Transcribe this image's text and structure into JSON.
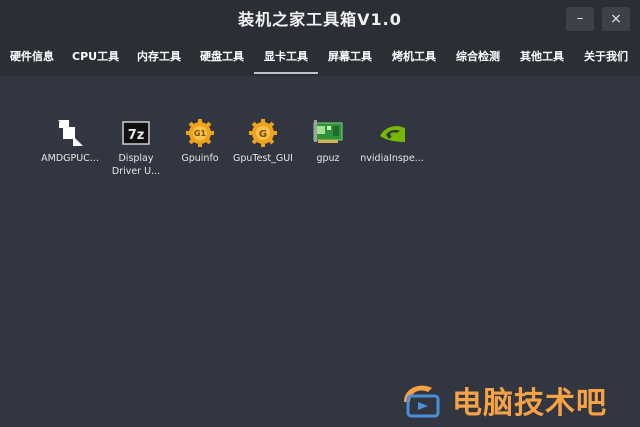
{
  "window": {
    "title": "装机之家工具箱V1.0",
    "minimize": "–",
    "close": "×"
  },
  "menu": {
    "items": [
      {
        "label": "硬件信息"
      },
      {
        "label": "CPU工具"
      },
      {
        "label": "内存工具"
      },
      {
        "label": "硬盘工具"
      },
      {
        "label": "显卡工具",
        "active": true
      },
      {
        "label": "屏幕工具"
      },
      {
        "label": "烤机工具"
      },
      {
        "label": "综合检测"
      },
      {
        "label": "其他工具"
      },
      {
        "label": "关于我们"
      }
    ]
  },
  "tools": [
    {
      "label": "AMDGPUC...",
      "icon": "amd-gpu-clock-icon"
    },
    {
      "label": "Display\nDriver U...",
      "icon": "7z-archive-icon"
    },
    {
      "label": "Gpuinfo",
      "icon": "gpuinfo-gear-icon"
    },
    {
      "label": "GpuTest_GUI",
      "icon": "gputest-gear-icon"
    },
    {
      "label": "gpuz",
      "icon": "graphics-card-icon"
    },
    {
      "label": "nvidiaInspe...",
      "icon": "nvidia-logo-icon"
    }
  ],
  "watermark": {
    "text": "电脑技术吧",
    "color": "#f7a245"
  }
}
